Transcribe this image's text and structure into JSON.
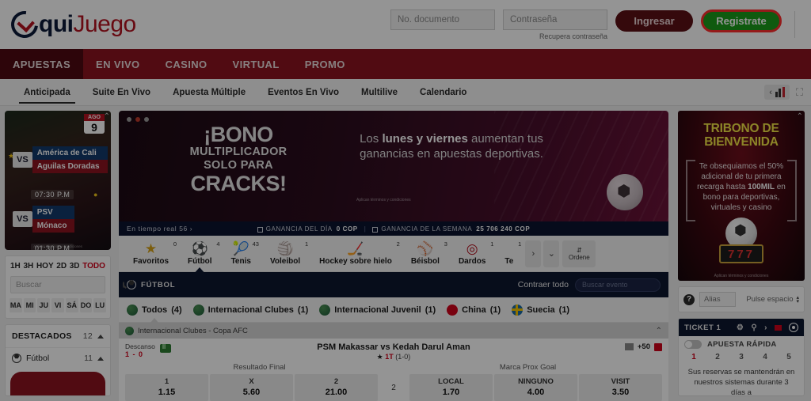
{
  "brand": {
    "aqui": "quiJuego",
    "aqui_part": "qui",
    "juego_part": "Juego"
  },
  "header": {
    "document_placeholder": "No. documento",
    "password_placeholder": "Contraseña",
    "recover_link": "Recupera contraseña",
    "login_button": "Ingresar",
    "register_button": "Registrate"
  },
  "mainnav": [
    {
      "label": "APUESTAS",
      "active": true
    },
    {
      "label": "EN VIVO",
      "active": false
    },
    {
      "label": "CASINO",
      "active": false
    },
    {
      "label": "VIRTUAL",
      "active": false
    },
    {
      "label": "PROMO",
      "active": false
    }
  ],
  "subnav": [
    {
      "label": "Anticipada",
      "active": true
    },
    {
      "label": "Suite En Vivo",
      "active": false
    },
    {
      "label": "Apuesta Múltiple",
      "active": false
    },
    {
      "label": "Eventos En Vivo",
      "active": false
    },
    {
      "label": "Multilive",
      "active": false
    },
    {
      "label": "Calendario",
      "active": false
    }
  ],
  "left_promo": {
    "month": "AGO",
    "day": "9",
    "match1": {
      "vs": "VS",
      "home": "América de Cali",
      "away": "Aguilas Doradas",
      "time": "07:30 P.M"
    },
    "match2": {
      "vs": "VS",
      "home": "PSV",
      "away": "Mónaco",
      "time": "01:30 P.M"
    },
    "legal": "Aplican términos y condiciones"
  },
  "left_filters": {
    "time_chips": [
      {
        "label": "1H",
        "active": false
      },
      {
        "label": "3H",
        "active": false
      },
      {
        "label": "HOY",
        "active": false
      },
      {
        "label": "2D",
        "active": false
      },
      {
        "label": "3D",
        "active": false
      },
      {
        "label": "TODO",
        "active": true
      }
    ],
    "search_placeholder": "Buscar",
    "days": [
      "MA",
      "MI",
      "JU",
      "VI",
      "SÁ",
      "DO",
      "LU"
    ]
  },
  "destacados": {
    "title": "DESTACADOS",
    "count": "12",
    "sports": [
      {
        "name": "Fútbol",
        "count": "11"
      }
    ]
  },
  "banner": {
    "line1": "¡BONO",
    "line2": "MULTIPLICADOR",
    "line3": "SOLO PARA",
    "line4": "CRACKS!",
    "right_pre": "Los ",
    "right_bold": "lunes y viernes",
    "right_rest": "aumentan tus ganancias en apuestas deportivas.",
    "legal": "Aplican términos y condiciones",
    "live_label": "En tiempo real",
    "live_count": "56",
    "gain_day_label": "GANANCIA DEL DÍA",
    "gain_day_value": "0 COP",
    "gain_week_label": "GANANCIA DE LA SEMANA",
    "gain_week_value": "25 706 240 COP"
  },
  "sports_strip": [
    {
      "name": "Favoritos",
      "count": "0",
      "icon": "★",
      "color": "#d4a017",
      "active": false
    },
    {
      "name": "Fútbol",
      "count": "4",
      "icon": "⚽",
      "color": "#222",
      "active": true
    },
    {
      "name": "Tenis",
      "count": "43",
      "icon": "🎾",
      "color": "#d4a017",
      "active": false
    },
    {
      "name": "Voleibol",
      "count": "1",
      "icon": "🏐",
      "color": "#1b6ca8",
      "active": false
    },
    {
      "name": "Hockey sobre hielo",
      "count": "2",
      "icon": "🏒",
      "color": "#c8701a",
      "active": false
    },
    {
      "name": "Béisbol",
      "count": "3",
      "icon": "⚾",
      "color": "#b4121f",
      "active": false
    },
    {
      "name": "Dardos",
      "count": "1",
      "icon": "◎",
      "color": "#b4121f",
      "active": false
    },
    {
      "name": "Te",
      "count": "1",
      "icon": "",
      "color": "#333",
      "active": false
    }
  ],
  "strip_controls": {
    "next": "›",
    "down": "⌄",
    "order_label": "Ordene",
    "order_icon": "⇵"
  },
  "futbol_bar": {
    "title": "FÚTBOL",
    "collapse_all": "Contraer todo",
    "search_placeholder": "Buscar evento"
  },
  "league_chips": [
    {
      "label": "Todos",
      "count": "(4)",
      "icon": "globe",
      "active": true
    },
    {
      "label": "Internacional Clubes",
      "count": "(1)",
      "icon": "globe",
      "active": false
    },
    {
      "label": "Internacional Juvenil",
      "count": "(1)",
      "icon": "globe",
      "active": false
    },
    {
      "label": "China",
      "count": "(1)",
      "icon": "flag-cn",
      "active": false
    },
    {
      "label": "Suecia",
      "count": "(1)",
      "icon": "flag-se",
      "active": false
    }
  ],
  "league_header": {
    "title": "Internacional Clubes - Copa AFC",
    "caret": "⌃"
  },
  "match": {
    "status_label": "Descanso",
    "score": "1 - 0",
    "title": "PSM Makassar vs Kedah Darul Aman",
    "period": "1T",
    "period_score": "(1-0)",
    "star": "★",
    "more_markets": "+50",
    "markets": [
      {
        "name": "Resultado Final",
        "odds": [
          {
            "key": "1",
            "value": "1.15"
          },
          {
            "key": "X",
            "value": "5.60"
          },
          {
            "key": "2",
            "value": "21.00"
          }
        ]
      },
      {
        "name": "Marca Prox Goal",
        "odds": [
          {
            "key": "LOCAL",
            "value": "1.70"
          },
          {
            "key": "NINGUNO",
            "value": "4.00"
          },
          {
            "key": "VISIT",
            "value": "3.50"
          }
        ]
      }
    ],
    "mid_count": "2"
  },
  "bonus_card": {
    "title_1": "TRIBONO DE",
    "title_2": "BIENVENIDA",
    "body_pre": "Te obsequiamos el 50% adicional de tu primera recarga hasta ",
    "body_bold": "100MIL",
    "body_post": " en bono para deportivas, virtuales y casino",
    "reel": "777",
    "legal": "Aplican términos y condiciones"
  },
  "alias_panel": {
    "help_icon": "?",
    "alias_placeholder": "Alias",
    "select_value": "Pulse espacio"
  },
  "ticket": {
    "title": "TICKET 1",
    "quick_bet_label": "APUESTA RÁPIDA",
    "tabs": [
      {
        "label": "1",
        "active": true
      },
      {
        "label": "2",
        "active": false
      },
      {
        "label": "3",
        "active": false
      },
      {
        "label": "4",
        "active": false
      },
      {
        "label": "5",
        "active": false
      }
    ],
    "note": "Sus reservas se mantendrán en nuestros sistemas durante 3 días a"
  }
}
